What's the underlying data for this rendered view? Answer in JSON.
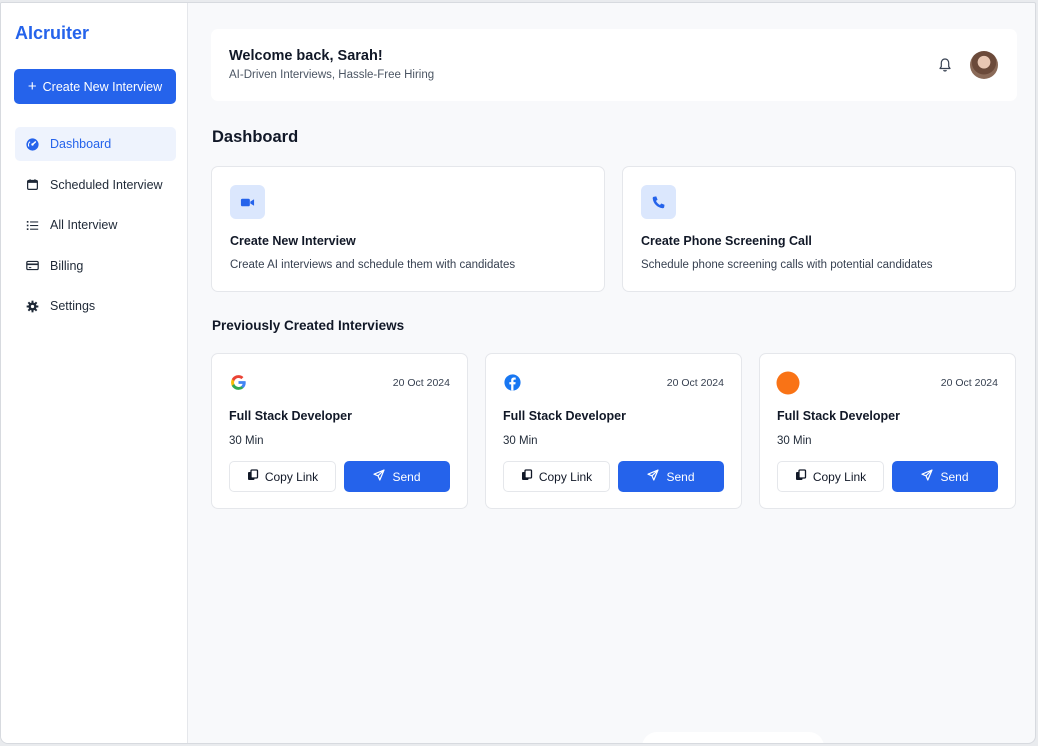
{
  "app": {
    "name": "AIcruiter",
    "brand_color": "#2563eb"
  },
  "sidebar": {
    "create_button": "Create New Interview",
    "items": [
      {
        "label": "Dashboard",
        "icon": "dashboard-icon",
        "active": true
      },
      {
        "label": "Scheduled Interview",
        "icon": "calendar-icon",
        "active": false
      },
      {
        "label": "All Interview",
        "icon": "list-icon",
        "active": false
      },
      {
        "label": "Billing",
        "icon": "credit-card-icon",
        "active": false
      },
      {
        "label": "Settings",
        "icon": "gear-icon",
        "active": false
      }
    ]
  },
  "header": {
    "welcome": "Welcome back, Sarah!",
    "subtitle": "AI-Driven Interviews, Hassle-Free Hiring",
    "notification_icon": "bell-icon",
    "avatar_icon": "user-avatar"
  },
  "main": {
    "title": "Dashboard",
    "actions": [
      {
        "title": "Create New Interview",
        "description": "Create AI interviews and schedule them with candidates",
        "icon": "video-camera-icon"
      },
      {
        "title": "Create Phone Screening Call",
        "description": "Schedule phone screening calls with potential candidates",
        "icon": "phone-icon"
      }
    ],
    "previous_title": "Previously Created Interviews",
    "interviews": [
      {
        "logo": "google-icon",
        "date": "20 Oct 2024",
        "role": "Full Stack Developer",
        "duration": "30 Min",
        "copy_label": "Copy Link",
        "send_label": "Send"
      },
      {
        "logo": "facebook-icon",
        "date": "20 Oct 2024",
        "role": "Full Stack Developer",
        "duration": "30 Min",
        "copy_label": "Copy Link",
        "send_label": "Send"
      },
      {
        "logo": "orange-circle-icon",
        "date": "20 Oct 2024",
        "role": "Full Stack Developer",
        "duration": "30 Min",
        "copy_label": "Copy Link",
        "send_label": "Send"
      }
    ]
  }
}
